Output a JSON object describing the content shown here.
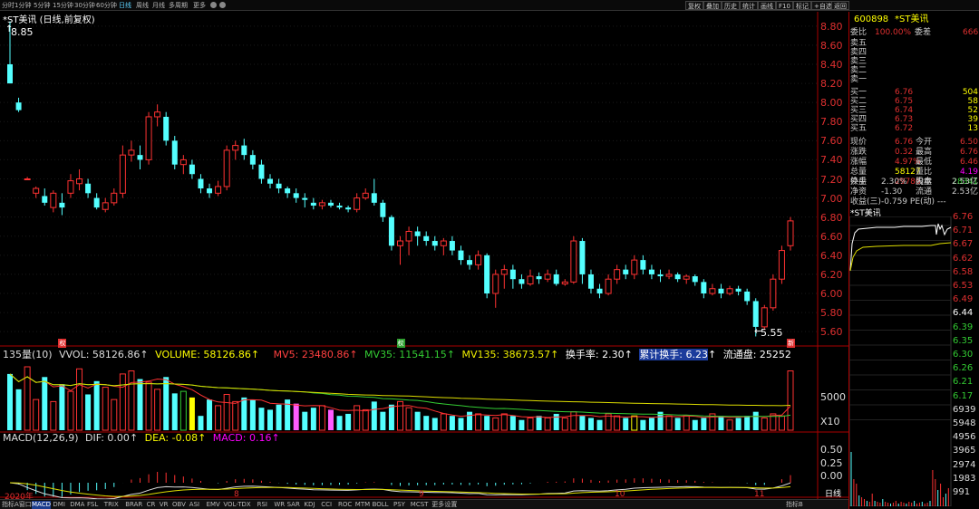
{
  "toolbar": {
    "tabs": [
      "分时",
      "1分钟",
      "5分钟",
      "15分钟",
      "30分钟",
      "60分钟",
      "日线",
      "周线",
      "月线",
      "多周期",
      "更多"
    ],
    "active_tab": "日线",
    "right_buttons": [
      "复权",
      "叠加",
      "历史",
      "统计",
      "画线",
      "F10",
      "标记",
      "+自选",
      "返回"
    ]
  },
  "chart_title": "*ST美讯 (日线,前复权)",
  "price_axis": [
    "8.80",
    "8.60",
    "8.40",
    "8.20",
    "8.00",
    "7.80",
    "7.60",
    "7.40",
    "7.20",
    "7.00",
    "6.80",
    "6.60",
    "6.40",
    "6.20",
    "6.00",
    "5.80",
    "5.60"
  ],
  "high_marker": "8.85",
  "low_marker": "5.55",
  "candles": [
    [
      8.4,
      8.2,
      8.85,
      8.2
    ],
    [
      8.0,
      7.92,
      8.05,
      7.9
    ],
    [
      7.2,
      7.2,
      7.22,
      7.2
    ],
    [
      7.05,
      7.1,
      7.12,
      7.0
    ],
    [
      7.02,
      6.95,
      7.1,
      6.92
    ],
    [
      6.9,
      7.05,
      7.08,
      6.85
    ],
    [
      6.95,
      6.9,
      7.05,
      6.82
    ],
    [
      7.05,
      7.18,
      7.25,
      7.0
    ],
    [
      7.15,
      7.2,
      7.3,
      7.08
    ],
    [
      7.15,
      7.05,
      7.2,
      7.0
    ],
    [
      7.0,
      6.9,
      7.05,
      6.88
    ],
    [
      6.88,
      6.95,
      7.0,
      6.85
    ],
    [
      6.95,
      7.05,
      7.1,
      6.92
    ],
    [
      7.05,
      7.45,
      7.55,
      7.0
    ],
    [
      7.45,
      7.5,
      7.6,
      7.38
    ],
    [
      7.45,
      7.4,
      7.55,
      7.3
    ],
    [
      7.4,
      7.85,
      7.9,
      7.35
    ],
    [
      7.85,
      7.9,
      7.98,
      7.75
    ],
    [
      7.85,
      7.6,
      7.9,
      7.55
    ],
    [
      7.6,
      7.35,
      7.65,
      7.3
    ],
    [
      7.35,
      7.4,
      7.45,
      7.25
    ],
    [
      7.35,
      7.25,
      7.4,
      7.2
    ],
    [
      7.2,
      7.1,
      7.25,
      7.05
    ],
    [
      7.1,
      7.05,
      7.15,
      7.0
    ],
    [
      7.05,
      7.12,
      7.18,
      7.02
    ],
    [
      7.12,
      7.5,
      7.55,
      7.08
    ],
    [
      7.5,
      7.55,
      7.6,
      7.4
    ],
    [
      7.55,
      7.45,
      7.62,
      7.4
    ],
    [
      7.45,
      7.35,
      7.5,
      7.3
    ],
    [
      7.35,
      7.2,
      7.4,
      7.15
    ],
    [
      7.2,
      7.15,
      7.25,
      7.1
    ],
    [
      7.15,
      7.1,
      7.2,
      7.05
    ],
    [
      7.1,
      7.05,
      7.12,
      7.0
    ],
    [
      7.05,
      7.0,
      7.1,
      6.95
    ],
    [
      7.0,
      6.98,
      7.05,
      6.9
    ],
    [
      6.95,
      6.92,
      7.0,
      6.88
    ],
    [
      6.92,
      6.95,
      6.98,
      6.88
    ],
    [
      6.95,
      6.92,
      6.98,
      6.9
    ],
    [
      6.92,
      6.9,
      6.95,
      6.88
    ],
    [
      6.9,
      6.88,
      6.92,
      6.85
    ],
    [
      6.88,
      7.0,
      7.05,
      6.85
    ],
    [
      7.0,
      7.05,
      7.1,
      6.98
    ],
    [
      7.05,
      6.95,
      7.2,
      6.92
    ],
    [
      6.95,
      6.8,
      6.98,
      6.75
    ],
    [
      6.8,
      6.5,
      6.82,
      6.45
    ],
    [
      6.5,
      6.55,
      6.6,
      6.3
    ],
    [
      6.55,
      6.65,
      6.7,
      6.4
    ],
    [
      6.65,
      6.6,
      6.7,
      6.5
    ],
    [
      6.6,
      6.55,
      6.65,
      6.5
    ],
    [
      6.55,
      6.5,
      6.6,
      6.45
    ],
    [
      6.5,
      6.55,
      6.58,
      6.4
    ],
    [
      6.55,
      6.45,
      6.6,
      6.4
    ],
    [
      6.45,
      6.35,
      6.5,
      6.3
    ],
    [
      6.35,
      6.3,
      6.4,
      6.25
    ],
    [
      6.3,
      6.4,
      6.45,
      6.25
    ],
    [
      6.4,
      6.0,
      6.42,
      5.95
    ],
    [
      6.0,
      6.2,
      6.25,
      5.85
    ],
    [
      6.2,
      6.25,
      6.3,
      6.05
    ],
    [
      6.25,
      6.15,
      6.3,
      6.05
    ],
    [
      6.15,
      6.1,
      6.2,
      6.05
    ],
    [
      6.1,
      6.18,
      6.25,
      6.08
    ],
    [
      6.18,
      6.15,
      6.22,
      6.1
    ],
    [
      6.15,
      6.2,
      6.25,
      6.12
    ],
    [
      6.2,
      6.1,
      6.25,
      6.08
    ],
    [
      6.1,
      6.12,
      6.15,
      6.08
    ],
    [
      6.12,
      6.55,
      6.6,
      6.1
    ],
    [
      6.55,
      6.2,
      6.58,
      6.1
    ],
    [
      6.2,
      6.05,
      6.25,
      6.0
    ],
    [
      6.05,
      6.0,
      6.1,
      5.95
    ],
    [
      6.0,
      6.15,
      6.2,
      5.98
    ],
    [
      6.15,
      6.25,
      6.3,
      6.1
    ],
    [
      6.25,
      6.2,
      6.3,
      6.15
    ],
    [
      6.2,
      6.35,
      6.4,
      6.15
    ],
    [
      6.35,
      6.25,
      6.4,
      6.2
    ],
    [
      6.25,
      6.2,
      6.3,
      6.15
    ],
    [
      6.2,
      6.18,
      6.25,
      6.12
    ],
    [
      6.18,
      6.2,
      6.25,
      6.15
    ],
    [
      6.2,
      6.15,
      6.22,
      6.12
    ],
    [
      6.15,
      6.18,
      6.2,
      6.1
    ],
    [
      6.18,
      6.12,
      6.2,
      6.08
    ],
    [
      6.12,
      6.0,
      6.15,
      5.95
    ],
    [
      6.0,
      6.05,
      6.1,
      5.98
    ],
    [
      6.05,
      6.0,
      6.1,
      5.95
    ],
    [
      6.0,
      6.05,
      6.08,
      5.98
    ],
    [
      6.05,
      6.02,
      6.08,
      5.98
    ],
    [
      6.02,
      5.92,
      6.05,
      5.88
    ],
    [
      5.92,
      5.65,
      5.95,
      5.55
    ],
    [
      5.65,
      5.85,
      5.88,
      5.62
    ],
    [
      5.85,
      6.15,
      6.2,
      5.82
    ],
    [
      6.15,
      6.45,
      6.5,
      6.1
    ],
    [
      6.5,
      6.76,
      6.8,
      6.45
    ]
  ],
  "markers": [
    {
      "index": 6,
      "label": "权",
      "color": "#e03030"
    },
    {
      "index": 45,
      "label": "权",
      "color": "#30a030"
    },
    {
      "index": 90,
      "label": "新",
      "color": "#e03030"
    }
  ],
  "volume": {
    "header": {
      "name": "135量(10)",
      "vvol_label": "VVOL: 58126.86",
      "volume_label": "VOLUME: 58126.86",
      "mv5_label": "MV5: 23480.86",
      "mv35_label": "MV35: 11541.15",
      "mv135_label": "MV135: 38673.57",
      "turnover_label": "换手率: 2.30",
      "cum_turnover_label": "累计换手: 6.23",
      "float_label": "流通盘: 25252"
    },
    "axis": [
      "5000",
      "X10"
    ],
    "values": [
      55,
      40,
      62,
      30,
      52,
      28,
      45,
      38,
      60,
      35,
      48,
      42,
      30,
      55,
      58,
      50,
      47,
      40,
      52,
      36,
      38,
      32,
      14,
      30,
      24,
      35,
      28,
      32,
      30,
      22,
      20,
      25,
      30,
      26,
      18,
      22,
      24,
      20,
      14,
      16,
      24,
      20,
      28,
      18,
      25,
      28,
      22,
      18,
      14,
      12,
      16,
      14,
      12,
      18,
      16,
      14,
      12,
      16,
      14,
      10,
      12,
      14,
      12,
      16,
      12,
      18,
      14,
      12,
      10,
      16,
      14,
      12,
      14,
      10,
      12,
      18,
      14,
      12,
      14,
      10,
      12,
      16,
      14,
      10,
      12,
      14,
      18,
      12,
      16,
      14,
      58
    ]
  },
  "macd": {
    "header": {
      "name": "MACD(12,26,9)",
      "dif_label": "DIF: 0.00",
      "dea_label": "DEA: -0.08",
      "macd_label": "MACD: 0.16"
    },
    "axis": [
      "0.50",
      "0.25",
      "0.00"
    ]
  },
  "x_axis": [
    "2020年",
    "8",
    "9",
    "10",
    "11"
  ],
  "bottom_tabs": [
    "指标A",
    "窗口",
    "MACD",
    "DMI",
    "DMA",
    "FSL",
    "TRIX",
    "BRAR",
    "CR",
    "VR",
    "OBV",
    "ASI",
    "EMV",
    "VOL-TDX",
    "RSI",
    "WR",
    "SAR",
    "KDJ",
    "CCI",
    "ROC",
    "MTM",
    "BOLL",
    "PSY",
    "MCST",
    "更多",
    "设置"
  ],
  "bottom_active": "MACD",
  "bottom_right": [
    "指标B",
    "日线"
  ],
  "quote": {
    "code": "600898",
    "name": "*ST美讯",
    "weibi_label": "委比",
    "weibi_value": "100.00%",
    "weicha_label": "委差",
    "weicha_value": "666",
    "asks": [
      {
        "label": "卖五",
        "price": "",
        "vol": ""
      },
      {
        "label": "卖四",
        "price": "",
        "vol": ""
      },
      {
        "label": "卖三",
        "price": "",
        "vol": ""
      },
      {
        "label": "卖二",
        "price": "",
        "vol": ""
      },
      {
        "label": "卖一",
        "price": "",
        "vol": ""
      }
    ],
    "bids": [
      {
        "label": "买一",
        "price": "6.76",
        "vol": "504"
      },
      {
        "label": "买二",
        "price": "6.75",
        "vol": "58"
      },
      {
        "label": "买三",
        "price": "6.74",
        "vol": "52"
      },
      {
        "label": "买四",
        "price": "6.73",
        "vol": "39"
      },
      {
        "label": "买五",
        "price": "6.72",
        "vol": "13"
      }
    ],
    "stats": [
      [
        "现价",
        "6.76",
        "今开",
        "6.50"
      ],
      [
        "涨跌",
        "0.32",
        "最高",
        "6.76"
      ],
      [
        "涨幅",
        "4.97%",
        "最低",
        "6.46"
      ],
      [
        "总量",
        "58127",
        "量比",
        "4.19"
      ],
      [
        "外盘",
        "29786",
        "内盘",
        "28341"
      ]
    ],
    "stats2": [
      [
        "换手",
        "2.30%",
        "股本",
        "2.53亿"
      ],
      [
        "净资",
        "-1.30",
        "流通",
        "2.53亿"
      ]
    ],
    "earnings": "收益(三)-0.759 PE(动) ---",
    "mini_title": "*ST美讯",
    "mini_axis": [
      "6.76",
      "6.71",
      "6.67",
      "6.62",
      "6.58",
      "6.53",
      "6.49",
      "6.44",
      "6.39",
      "6.35",
      "6.30",
      "6.26",
      "6.21",
      "6.17",
      "6939",
      "5948",
      "4956",
      "3965",
      "2974",
      "1983",
      "991"
    ]
  }
}
